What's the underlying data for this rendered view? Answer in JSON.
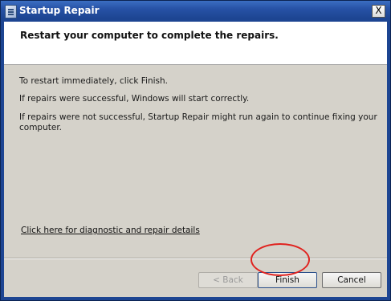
{
  "window": {
    "title": "Startup Repair",
    "close_glyph": "X",
    "title_icon": "startup-repair-icon"
  },
  "header": {
    "heading": "Restart your computer to complete the repairs."
  },
  "body": {
    "line1": "To restart immediately, click Finish.",
    "line2": "If repairs were successful, Windows will start correctly.",
    "line3a": "If repairs were not successful, Startup Repair might run again to continue fixing your",
    "line3b": "computer.",
    "details_link": "Click here for diagnostic and repair details"
  },
  "buttons": {
    "back": "< Back",
    "finish": "Finish",
    "cancel": "Cancel"
  },
  "colors": {
    "titlebar": "#1d4592",
    "client_bg": "#d5d2ca",
    "highlight": "#e0231f"
  }
}
